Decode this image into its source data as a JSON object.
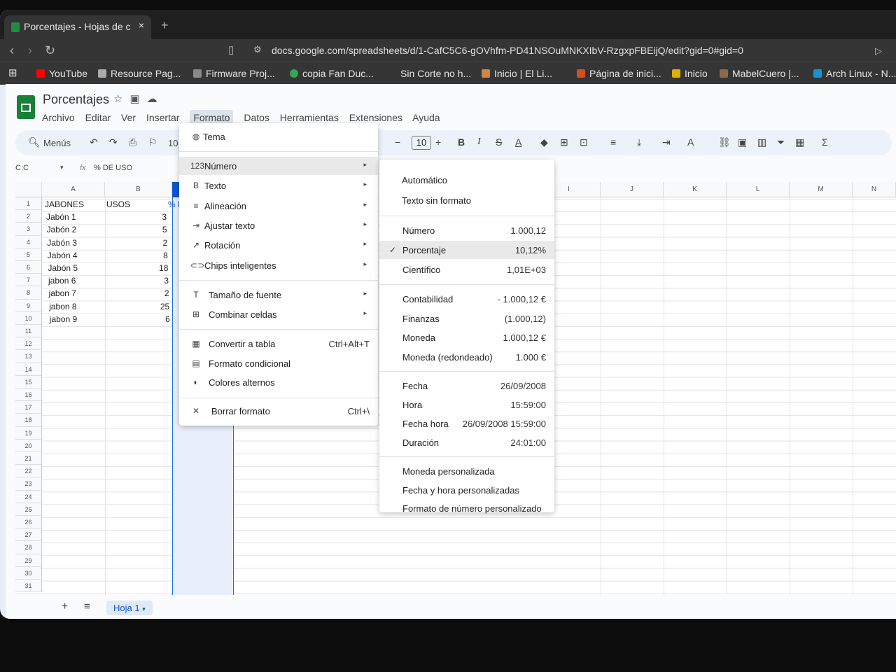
{
  "browser": {
    "tab_title": "Porcentajes - Hojas de c",
    "tab_close": "×",
    "new_tab": "+",
    "url": "docs.google.com/spreadsheets/d/1-CafC5C6-gOVhfm-PD41NSOuMNKXIbV-RzgxpFBEijQ/edit?gid=0#gid=0",
    "bookmarks": [
      {
        "label": "YouTube",
        "color": "#ff0000"
      },
      {
        "label": "Resource Pag...",
        "color": "#aaaaaa"
      },
      {
        "label": "Firmware Proj...",
        "color": "#888888"
      },
      {
        "label": "copia Fan Duc...",
        "color": "#3aa35a"
      },
      {
        "label": "Sin Corte no h...",
        "color": ""
      },
      {
        "label": "Inicio | El Li...",
        "color": "#cc8844"
      },
      {
        "label": "Página de inici...",
        "color": "#d05020"
      },
      {
        "label": "Inicio",
        "color": "#e0b000"
      },
      {
        "label": "MabelCuero |...",
        "color": "#8a6a4a"
      },
      {
        "label": "Arch Linux - N...",
        "color": "#1793d1"
      }
    ]
  },
  "doc": {
    "title": "Porcentajes",
    "menus": [
      "Archivo",
      "Editar",
      "Ver",
      "Insertar",
      "Formato",
      "Datos",
      "Herramientas",
      "Extensiones",
      "Ayuda"
    ],
    "active_menu": "Formato"
  },
  "toolbar": {
    "search_label": "Menús",
    "zoom_partial": "10",
    "font_size": "10",
    "minus": "−",
    "plus": "+"
  },
  "formula_bar": {
    "name_box": "C:C",
    "fx": "fx",
    "content": "% DE USO"
  },
  "grid": {
    "columns": [
      "A",
      "B",
      "",
      "I",
      "J",
      "K",
      "L",
      "M",
      "N"
    ],
    "header_row": [
      "JABONES",
      "USOS",
      "% DI"
    ],
    "rows": [
      {
        "name": "Jabón 1",
        "usos": "3"
      },
      {
        "name": "Jabón 2",
        "usos": "5"
      },
      {
        "name": "Jabón 3",
        "usos": "2"
      },
      {
        "name": "Jabón 4",
        "usos": "8"
      },
      {
        "name": "Jabón 5",
        "usos": "18"
      },
      {
        "name": "jabon 6",
        "usos": "3"
      },
      {
        "name": "jabon 7",
        "usos": "2"
      },
      {
        "name": "jabon 8",
        "usos": "25"
      },
      {
        "name": "jabon 9",
        "usos": "6"
      }
    ],
    "row_numbers": [
      "1",
      "2",
      "3",
      "4",
      "5",
      "6",
      "7",
      "8",
      "9",
      "10",
      "11",
      "12",
      "13",
      "14",
      "15",
      "16",
      "17",
      "18",
      "19",
      "20",
      "21",
      "22",
      "23",
      "24",
      "25",
      "26",
      "27",
      "28",
      "29",
      "30",
      "31"
    ]
  },
  "sheet_tabs": {
    "add": "+",
    "list": "≡",
    "current": "Hoja 1"
  },
  "formato_menu": {
    "tema": "Tema",
    "items": [
      {
        "label": "Número",
        "icon": "123",
        "submenu": true
      },
      {
        "label": "Texto",
        "icon": "B",
        "submenu": true
      },
      {
        "label": "Alineación",
        "icon": "≡",
        "submenu": true
      },
      {
        "label": "Ajustar texto",
        "icon": "⇥",
        "submenu": true
      },
      {
        "label": "Rotación",
        "icon": "↗",
        "submenu": true
      },
      {
        "label": "Chips inteligentes",
        "icon": "⊂⊃",
        "submenu": true
      }
    ],
    "items2": [
      {
        "label": "Tamaño de fuente",
        "icon": "T",
        "submenu": true
      },
      {
        "label": "Combinar celdas",
        "icon": "⊞",
        "submenu": true
      }
    ],
    "items3": [
      {
        "label": "Convertir a tabla",
        "icon": "▦",
        "shortcut": "Ctrl+Alt+T"
      },
      {
        "label": "Formato condicional",
        "icon": "▤",
        "shortcut": ""
      },
      {
        "label": "Colores alternos",
        "icon": "◐",
        "shortcut": ""
      }
    ],
    "borrar": {
      "label": "Borrar formato",
      "icon": "✕",
      "shortcut": "Ctrl+\\"
    }
  },
  "numero_submenu": {
    "group1": [
      {
        "label": "Automático",
        "value": ""
      },
      {
        "label": "Texto sin formato",
        "value": ""
      }
    ],
    "group2": [
      {
        "label": "Número",
        "value": "1.000,12"
      },
      {
        "label": "Porcentaje",
        "value": "10,12%"
      },
      {
        "label": "Científico",
        "value": "1,01E+03"
      }
    ],
    "group3": [
      {
        "label": "Contabilidad",
        "value": "- 1.000,12 €"
      },
      {
        "label": "Finanzas",
        "value": "(1.000,12)"
      },
      {
        "label": "Moneda",
        "value": "1.000,12 €"
      },
      {
        "label": "Moneda (redondeado)",
        "value": "1.000 €"
      }
    ],
    "group4": [
      {
        "label": "Fecha",
        "value": "26/09/2008"
      },
      {
        "label": "Hora",
        "value": "15:59:00"
      },
      {
        "label": "Fecha hora",
        "value": "26/09/2008 15:59:00"
      },
      {
        "label": "Duración",
        "value": "24:01:00"
      }
    ],
    "group5": [
      {
        "label": "Moneda personalizada",
        "value": ""
      },
      {
        "label": "Fecha y hora personalizadas",
        "value": ""
      },
      {
        "label": "Formato de número personalizado",
        "value": ""
      }
    ],
    "checked": "Porcentaje",
    "check_mark": "✓"
  }
}
